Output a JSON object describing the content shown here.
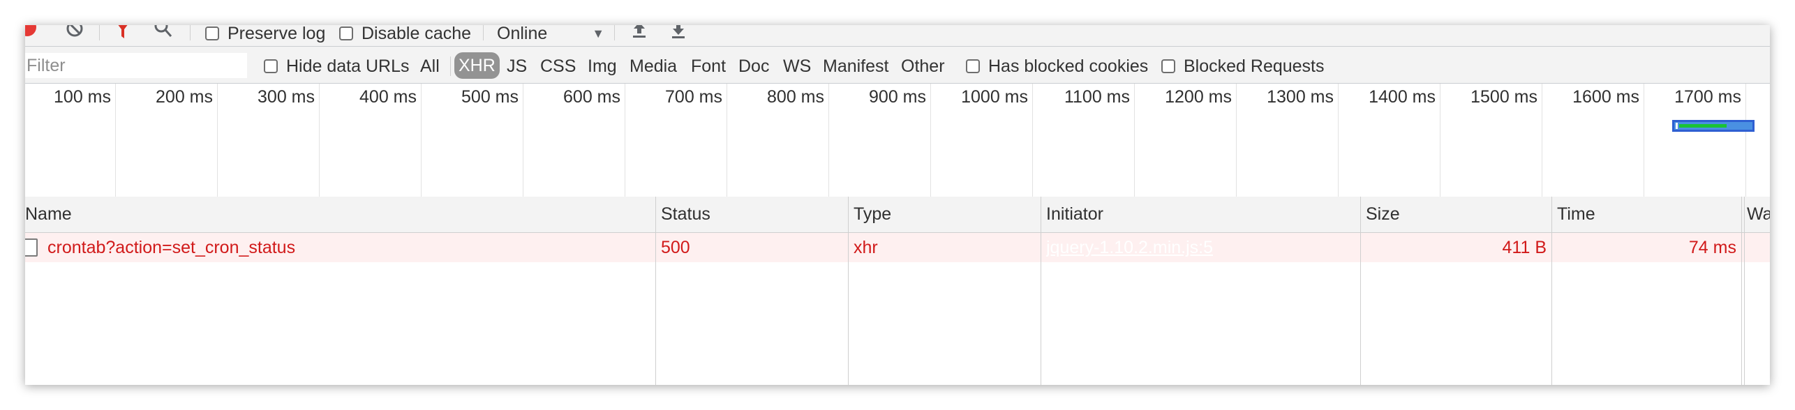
{
  "toolbar": {
    "preserve_log": "Preserve log",
    "disable_cache": "Disable cache",
    "throttle": "Online"
  },
  "filter_bar": {
    "placeholder": "Filter",
    "hide_data_urls": "Hide data URLs",
    "types": [
      "All",
      "XHR",
      "JS",
      "CSS",
      "Img",
      "Media",
      "Font",
      "Doc",
      "WS",
      "Manifest",
      "Other"
    ],
    "selected_type": "XHR",
    "has_blocked_cookies": "Has blocked cookies",
    "blocked_requests": "Blocked Requests"
  },
  "overview": {
    "ticks": [
      "100 ms",
      "200 ms",
      "300 ms",
      "400 ms",
      "500 ms",
      "600 ms",
      "700 ms",
      "800 ms",
      "900 ms",
      "1000 ms",
      "1100 ms",
      "1200 ms",
      "1300 ms",
      "1400 ms",
      "1500 ms",
      "1600 ms",
      "1700 ms"
    ]
  },
  "table": {
    "columns": [
      "Name",
      "Status",
      "Type",
      "Initiator",
      "Size",
      "Time",
      "Wa"
    ],
    "rows": [
      {
        "name": "crontab?action=set_cron_status",
        "status": "500",
        "type": "xhr",
        "initiator": "jquery-1.10.2.min.js:5",
        "size": "411 B",
        "time": "74 ms"
      }
    ]
  },
  "colors": {
    "error_text": "#d11a1a",
    "error_row_bg": "#fef0f0",
    "record_red": "#e53935",
    "filter_red": "#d93025",
    "selected_pill": "#939393"
  }
}
